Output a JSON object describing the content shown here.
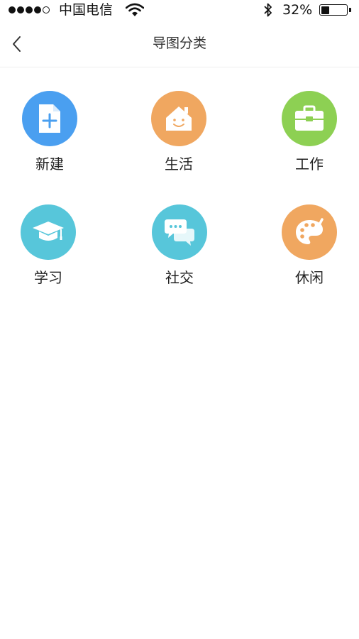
{
  "status_bar": {
    "carrier": "中国电信",
    "battery_percent": "32%",
    "battery_level": 0.32
  },
  "nav": {
    "title": "导图分类"
  },
  "categories": [
    {
      "label": "新建",
      "icon": "add-document-icon",
      "color": "#4a9ff0"
    },
    {
      "label": "生活",
      "icon": "house-icon",
      "color": "#f0a760"
    },
    {
      "label": "工作",
      "icon": "briefcase-icon",
      "color": "#8dd053"
    },
    {
      "label": "学习",
      "icon": "graduation-cap-icon",
      "color": "#57c6da"
    },
    {
      "label": "社交",
      "icon": "chat-bubbles-icon",
      "color": "#57c6da"
    },
    {
      "label": "休闲",
      "icon": "palette-icon",
      "color": "#f0a760"
    }
  ]
}
